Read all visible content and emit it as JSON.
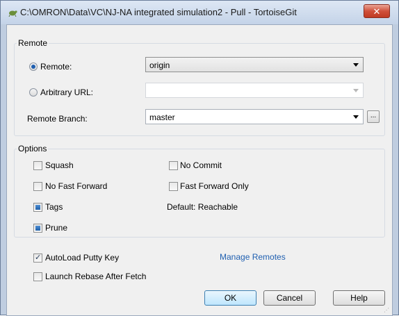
{
  "window": {
    "title": "C:\\OMRON\\Data\\VC\\NJ-NA integrated simulation2 - Pull - TortoiseGit",
    "close_label": "✕"
  },
  "remote_group": {
    "label": "Remote",
    "remote_radio_label": "Remote:",
    "remote_value": "origin",
    "arbitrary_radio_label": "Arbitrary URL:",
    "arbitrary_value": "",
    "remote_branch_label": "Remote Branch:",
    "remote_branch_value": "master",
    "browse_label": "..."
  },
  "options_group": {
    "label": "Options",
    "squash": "Squash",
    "no_commit": "No Commit",
    "no_fast_forward": "No Fast Forward",
    "fast_forward_only": "Fast Forward Only",
    "tags": "Tags",
    "tags_default": "Default: Reachable",
    "prune": "Prune"
  },
  "bottom": {
    "autoload_putty": "AutoLoad Putty Key",
    "manage_remotes": "Manage Remotes",
    "launch_rebase": "Launch Rebase After Fetch"
  },
  "buttons": {
    "ok": "OK",
    "cancel": "Cancel",
    "help": "Help"
  },
  "colors": {
    "accent": "#1f5fb0",
    "close_red": "#c03a22",
    "window_frame": "#bfcde0"
  }
}
